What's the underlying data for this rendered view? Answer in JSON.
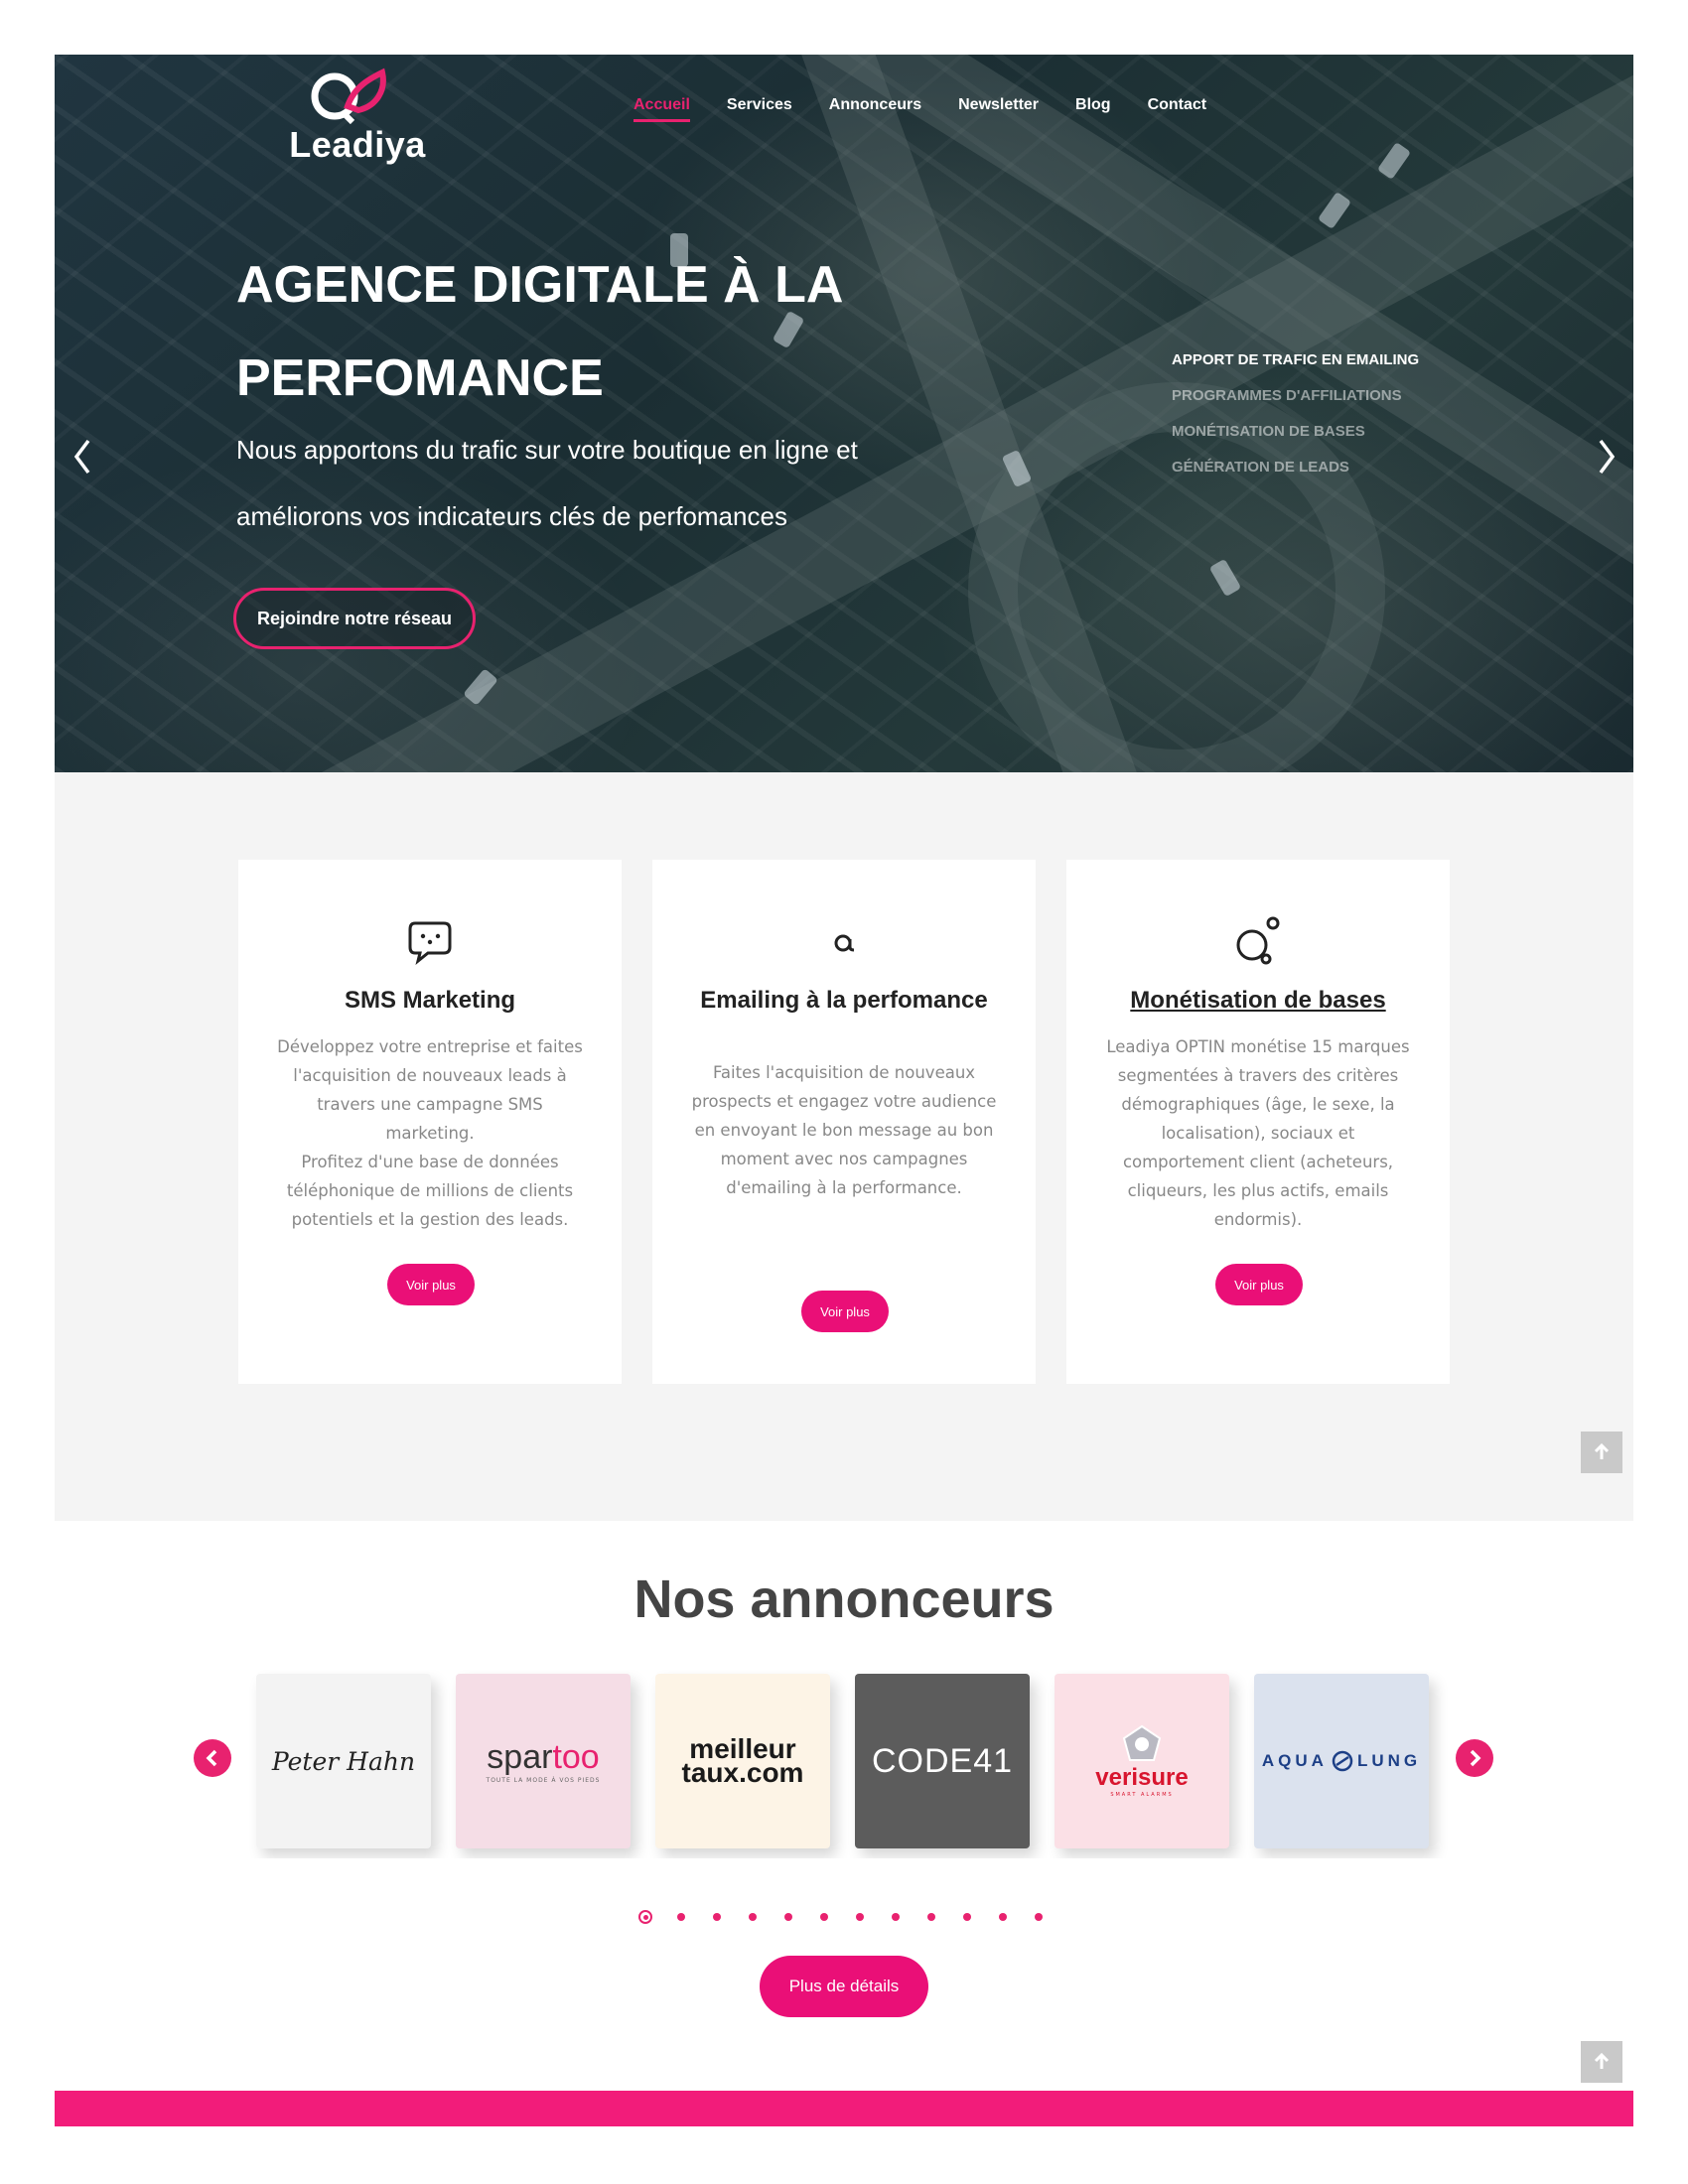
{
  "brand": {
    "name": "Leadiya",
    "accent": "#e8226f",
    "button_color": "#ea0f77"
  },
  "nav": {
    "items": [
      {
        "label": "Accueil",
        "active": true
      },
      {
        "label": "Services"
      },
      {
        "label": "Annonceurs"
      },
      {
        "label": "Newsletter"
      },
      {
        "label": "Blog"
      },
      {
        "label": "Contact"
      }
    ]
  },
  "hero": {
    "title_line1": "AGENCE DIGITALE À LA",
    "title_line2": "PERFOMANCE",
    "subtitle_line1": "Nous apportons du trafic sur votre boutique en ligne et",
    "subtitle_line2": "améliorons vos indicateurs clés de perfomances",
    "cta": "Rejoindre notre réseau",
    "list": [
      "APPORT DE TRAFIC EN EMAILING",
      "PROGRAMMES D'AFFILIATIONS",
      "MONÉTISATION DE BASES",
      "GÉNÉRATION DE LEADS"
    ],
    "prev_icon": "chevron-left-icon",
    "next_icon": "chevron-right-icon"
  },
  "services": [
    {
      "icon": "chat-bubble-icon",
      "title": "SMS Marketing",
      "text": "Développez votre entreprise et faites l'acquisition de nouveaux leads à travers une campagne SMS marketing.\nProfitez d'une base de données téléphonique de millions de clients potentiels et la gestion des leads.",
      "button": "Voir plus"
    },
    {
      "icon": "at-sign-icon",
      "title": "Emailing à la perfomance",
      "text": "Faites l'acquisition de nouveaux prospects et engagez votre audience en envoyant le bon message au bon moment avec nos campagnes d'emailing à la performance.",
      "button": "Voir plus"
    },
    {
      "icon": "circles-icon",
      "title": "Monétisation de bases",
      "text": "Leadiya OPTIN monétise 15 marques segmentées à travers des critères démographiques (âge, le sexe, la localisation), sociaux et comportement client (acheteurs, cliqueurs, les plus actifs, emails endormis).",
      "button": "Voir plus"
    }
  ],
  "annonceurs": {
    "title": "Nos annonceurs",
    "logos": [
      {
        "name": "Peter Hahn",
        "bg": "#f3f3f3",
        "text": "Peter Hahn"
      },
      {
        "name": "spartoo",
        "bg": "#f5dde6",
        "text_a": "spar",
        "text_b": "too",
        "tagline": "TOUTE LA MODE À VOS PIEDS"
      },
      {
        "name": "meilleurtaux.com",
        "bg": "#fdf4e6",
        "text_a": "meilleur",
        "text_b": "taux.com"
      },
      {
        "name": "CODE 41",
        "bg": "#5c5c5c",
        "text": "CODE41"
      },
      {
        "name": "verisure",
        "bg": "#fbe0e6",
        "text": "verisure",
        "tagline": "SMART ALARMS"
      },
      {
        "name": "Aqua Lung",
        "bg": "#dbe2ee",
        "text_a": "AQUA",
        "text_b": "LUNG"
      }
    ],
    "dots_total": 12,
    "active_dot": 1,
    "more_button": "Plus de détails"
  },
  "to_top_icon": "arrow-up-icon"
}
